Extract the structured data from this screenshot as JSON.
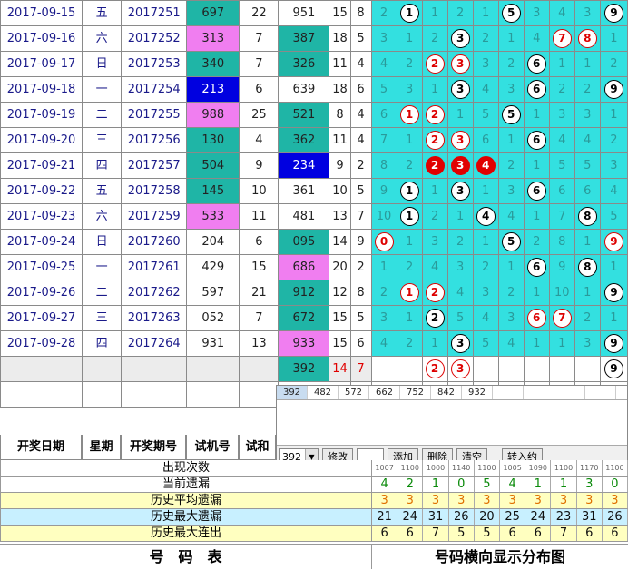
{
  "rows": [
    {
      "date": "2017-09-15",
      "weekday": "五",
      "period": "2017251",
      "trial": "697",
      "trialColor": "#1fb5a6",
      "sum": "22",
      "winning": "951",
      "winColor": "#fff",
      "span": "15",
      "last": "8",
      "dist": [
        [
          "2",
          "t"
        ],
        [
          "1",
          "k"
        ],
        [
          "1",
          "t"
        ],
        [
          "2",
          "t"
        ],
        [
          "1",
          "t"
        ],
        [
          "5",
          "k"
        ],
        [
          "3",
          "t"
        ],
        [
          "4",
          "t"
        ],
        [
          "3",
          "t"
        ],
        [
          "9",
          "k"
        ]
      ]
    },
    {
      "date": "2017-09-16",
      "weekday": "六",
      "period": "2017252",
      "trial": "313",
      "trialColor": "#f07ef0",
      "sum": "7",
      "winning": "387",
      "winColor": "#1fb5a6",
      "span": "18",
      "last": "5",
      "dist": [
        [
          "3",
          "t"
        ],
        [
          "1",
          "t"
        ],
        [
          "2",
          "t"
        ],
        [
          "3",
          "k"
        ],
        [
          "2",
          "t"
        ],
        [
          "1",
          "t"
        ],
        [
          "4",
          "t"
        ],
        [
          "7",
          "r"
        ],
        [
          "8",
          "r"
        ],
        [
          "1",
          "t"
        ]
      ]
    },
    {
      "date": "2017-09-17",
      "weekday": "日",
      "period": "2017253",
      "trial": "340",
      "trialColor": "#1fb5a6",
      "sum": "7",
      "winning": "326",
      "winColor": "#1fb5a6",
      "span": "11",
      "last": "4",
      "dist": [
        [
          "4",
          "t"
        ],
        [
          "2",
          "t"
        ],
        [
          "2",
          "r"
        ],
        [
          "3",
          "r"
        ],
        [
          "3",
          "t"
        ],
        [
          "2",
          "t"
        ],
        [
          "6",
          "k"
        ],
        [
          "1",
          "t"
        ],
        [
          "1",
          "t"
        ],
        [
          "2",
          "t"
        ]
      ]
    },
    {
      "date": "2017-09-18",
      "weekday": "一",
      "period": "2017254",
      "trial": "213",
      "trialColor": "#0000e0",
      "sum": "6",
      "winning": "639",
      "winColor": "#fff",
      "span": "18",
      "last": "6",
      "dist": [
        [
          "5",
          "t"
        ],
        [
          "3",
          "t"
        ],
        [
          "1",
          "t"
        ],
        [
          "3",
          "k"
        ],
        [
          "4",
          "t"
        ],
        [
          "3",
          "t"
        ],
        [
          "6",
          "k"
        ],
        [
          "2",
          "t"
        ],
        [
          "2",
          "t"
        ],
        [
          "9",
          "k"
        ]
      ]
    },
    {
      "date": "2017-09-19",
      "weekday": "二",
      "period": "2017255",
      "trial": "988",
      "trialColor": "#f07ef0",
      "sum": "25",
      "winning": "521",
      "winColor": "#1fb5a6",
      "span": "8",
      "last": "4",
      "dist": [
        [
          "6",
          "t"
        ],
        [
          "1",
          "r"
        ],
        [
          "2",
          "r"
        ],
        [
          "1",
          "t"
        ],
        [
          "5",
          "t"
        ],
        [
          "5",
          "k"
        ],
        [
          "1",
          "t"
        ],
        [
          "3",
          "t"
        ],
        [
          "3",
          "t"
        ],
        [
          "1",
          "t"
        ]
      ]
    },
    {
      "date": "2017-09-20",
      "weekday": "三",
      "period": "2017256",
      "trial": "130",
      "trialColor": "#1fb5a6",
      "sum": "4",
      "winning": "362",
      "winColor": "#1fb5a6",
      "span": "11",
      "last": "4",
      "dist": [
        [
          "7",
          "t"
        ],
        [
          "1",
          "t"
        ],
        [
          "2",
          "r"
        ],
        [
          "3",
          "r"
        ],
        [
          "6",
          "t"
        ],
        [
          "1",
          "t"
        ],
        [
          "6",
          "k"
        ],
        [
          "4",
          "t"
        ],
        [
          "4",
          "t"
        ],
        [
          "2",
          "t"
        ]
      ]
    },
    {
      "date": "2017-09-21",
      "weekday": "四",
      "period": "2017257",
      "trial": "504",
      "trialColor": "#1fb5a6",
      "sum": "9",
      "winning": "234",
      "winColor": "#0000e0",
      "span": "9",
      "last": "2",
      "dist": [
        [
          "8",
          "t"
        ],
        [
          "2",
          "t"
        ],
        [
          "2",
          "f"
        ],
        [
          "3",
          "f"
        ],
        [
          "4",
          "f"
        ],
        [
          "2",
          "t"
        ],
        [
          "1",
          "t"
        ],
        [
          "5",
          "t"
        ],
        [
          "5",
          "t"
        ],
        [
          "3",
          "t"
        ]
      ]
    },
    {
      "date": "2017-09-22",
      "weekday": "五",
      "period": "2017258",
      "trial": "145",
      "trialColor": "#1fb5a6",
      "sum": "10",
      "winning": "361",
      "winColor": "#fff",
      "span": "10",
      "last": "5",
      "dist": [
        [
          "9",
          "t"
        ],
        [
          "1",
          "k"
        ],
        [
          "1",
          "t"
        ],
        [
          "3",
          "k"
        ],
        [
          "1",
          "t"
        ],
        [
          "3",
          "t"
        ],
        [
          "6",
          "k"
        ],
        [
          "6",
          "t"
        ],
        [
          "6",
          "t"
        ],
        [
          "4",
          "t"
        ]
      ]
    },
    {
      "date": "2017-09-23",
      "weekday": "六",
      "period": "2017259",
      "trial": "533",
      "trialColor": "#f07ef0",
      "sum": "11",
      "winning": "481",
      "winColor": "#fff",
      "span": "13",
      "last": "7",
      "dist": [
        [
          "10",
          "t"
        ],
        [
          "1",
          "k"
        ],
        [
          "2",
          "t"
        ],
        [
          "1",
          "t"
        ],
        [
          "4",
          "k"
        ],
        [
          "4",
          "t"
        ],
        [
          "1",
          "t"
        ],
        [
          "7",
          "t"
        ],
        [
          "8",
          "k"
        ],
        [
          "5",
          "t"
        ]
      ]
    },
    {
      "date": "2017-09-24",
      "weekday": "日",
      "period": "2017260",
      "trial": "204",
      "trialColor": "#fff",
      "sum": "6",
      "winning": "095",
      "winColor": "#1fb5a6",
      "span": "14",
      "last": "9",
      "dist": [
        [
          "0",
          "r"
        ],
        [
          "1",
          "t"
        ],
        [
          "3",
          "t"
        ],
        [
          "2",
          "t"
        ],
        [
          "1",
          "t"
        ],
        [
          "5",
          "k"
        ],
        [
          "2",
          "t"
        ],
        [
          "8",
          "t"
        ],
        [
          "1",
          "t"
        ],
        [
          "9",
          "r"
        ]
      ]
    },
    {
      "date": "2017-09-25",
      "weekday": "一",
      "period": "2017261",
      "trial": "429",
      "trialColor": "#fff",
      "sum": "15",
      "winning": "686",
      "winColor": "#f07ef0",
      "span": "20",
      "last": "2",
      "dist": [
        [
          "1",
          "t"
        ],
        [
          "2",
          "t"
        ],
        [
          "4",
          "t"
        ],
        [
          "3",
          "t"
        ],
        [
          "2",
          "t"
        ],
        [
          "1",
          "t"
        ],
        [
          "6",
          "k"
        ],
        [
          "9",
          "t"
        ],
        [
          "8",
          "k"
        ],
        [
          "1",
          "t"
        ]
      ]
    },
    {
      "date": "2017-09-26",
      "weekday": "二",
      "period": "2017262",
      "trial": "597",
      "trialColor": "#fff",
      "sum": "21",
      "winning": "912",
      "winColor": "#1fb5a6",
      "span": "12",
      "last": "8",
      "dist": [
        [
          "2",
          "t"
        ],
        [
          "1",
          "r"
        ],
        [
          "2",
          "r"
        ],
        [
          "4",
          "t"
        ],
        [
          "3",
          "t"
        ],
        [
          "2",
          "t"
        ],
        [
          "1",
          "t"
        ],
        [
          "10",
          "t"
        ],
        [
          "1",
          "t"
        ],
        [
          "9",
          "k"
        ]
      ]
    },
    {
      "date": "2017-09-27",
      "weekday": "三",
      "period": "2017263",
      "trial": "052",
      "trialColor": "#fff",
      "sum": "7",
      "winning": "672",
      "winColor": "#1fb5a6",
      "span": "15",
      "last": "5",
      "dist": [
        [
          "3",
          "t"
        ],
        [
          "1",
          "t"
        ],
        [
          "2",
          "k"
        ],
        [
          "5",
          "t"
        ],
        [
          "4",
          "t"
        ],
        [
          "3",
          "t"
        ],
        [
          "6",
          "r"
        ],
        [
          "7",
          "r"
        ],
        [
          "2",
          "t"
        ],
        [
          "1",
          "t"
        ]
      ]
    },
    {
      "date": "2017-09-28",
      "weekday": "四",
      "period": "2017264",
      "trial": "931",
      "trialColor": "#fff",
      "sum": "13",
      "winning": "933",
      "winColor": "#f07ef0",
      "span": "15",
      "last": "6",
      "dist": [
        [
          "4",
          "t"
        ],
        [
          "2",
          "t"
        ],
        [
          "1",
          "t"
        ],
        [
          "3",
          "k"
        ],
        [
          "5",
          "t"
        ],
        [
          "4",
          "t"
        ],
        [
          "1",
          "t"
        ],
        [
          "1",
          "t"
        ],
        [
          "3",
          "t"
        ],
        [
          "9",
          "k"
        ]
      ]
    }
  ],
  "predictRow": {
    "winning": "392",
    "span": "14",
    "last": "7",
    "balls": [
      [
        "",
        ""
      ],
      [
        "",
        ""
      ],
      [
        "2",
        "r"
      ],
      [
        "3",
        "r"
      ],
      [
        "",
        ""
      ],
      [
        "",
        ""
      ],
      [
        "",
        ""
      ],
      [
        "",
        ""
      ],
      [
        "",
        ""
      ],
      [
        "9",
        "k"
      ]
    ]
  },
  "headers": [
    "开奖日期",
    "星期",
    "开奖期号",
    "试机号",
    "试和"
  ],
  "panel": {
    "tabs": [
      "392",
      "482",
      "572",
      "662",
      "752",
      "842",
      "932",
      "",
      "",
      "",
      ""
    ],
    "select_value": "392",
    "modify_label": "修改",
    "add_label": "添加",
    "delete_label": "删除",
    "clear_label": "清空",
    "import_label": "转入约"
  },
  "stats": [
    {
      "label": "出现次数",
      "color": "#111",
      "bg": "#fff",
      "values": [
        "1007",
        "1100",
        "1000",
        "1140",
        "1100",
        "1005",
        "1090",
        "1100",
        "1170",
        "1100"
      ]
    },
    {
      "label": "当前遗漏",
      "color": "#0a8a0a",
      "bg": "#fff",
      "values": [
        "4",
        "2",
        "1",
        "0",
        "5",
        "4",
        "1",
        "1",
        "3",
        "0"
      ]
    },
    {
      "label": "历史平均遗漏",
      "color": "#e07000",
      "bg": "#ffffc0",
      "values": [
        "3",
        "3",
        "3",
        "3",
        "3",
        "3",
        "3",
        "3",
        "3",
        "3"
      ]
    },
    {
      "label": "历史最大遗漏",
      "color": "#111",
      "bg": "#c8f0ff",
      "values": [
        "21",
        "24",
        "31",
        "26",
        "20",
        "25",
        "24",
        "23",
        "31",
        "26"
      ]
    },
    {
      "label": "历史最大连出",
      "color": "#111",
      "bg": "#ffffc0",
      "values": [
        "6",
        "6",
        "7",
        "5",
        "5",
        "6",
        "6",
        "7",
        "6",
        "6"
      ]
    }
  ],
  "footer": {
    "left": "号　码　表",
    "right": "号码横向显示分布图"
  }
}
